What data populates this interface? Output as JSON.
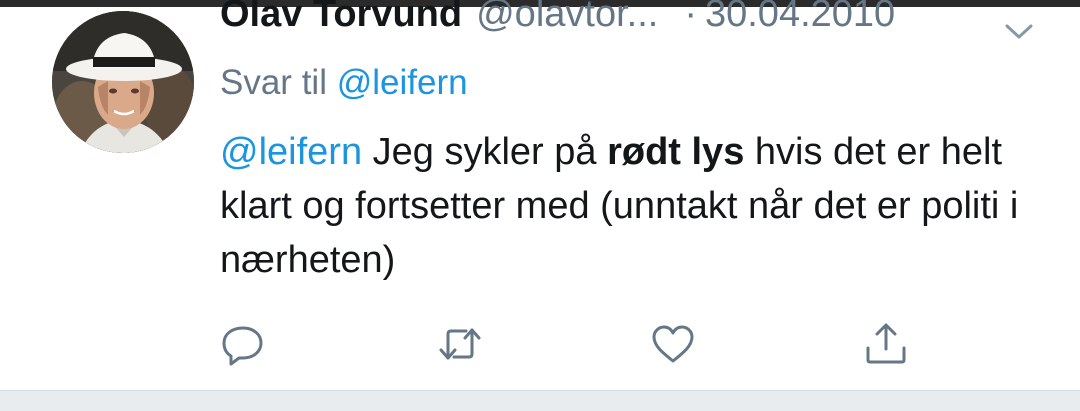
{
  "tweet": {
    "author_name": "Olav Torvund",
    "author_handle": "@olavtor...",
    "separator": "·",
    "date": "30.04.2010",
    "reply_prefix": "Svar til",
    "reply_to": "@leifern",
    "body": {
      "mention": "@leifern",
      "text_1": " Jeg sykler på ",
      "bold": "rødt lys",
      "text_2": " hvis det er helt klart og fortsetter med (unntakt når det er politi i nærheten)"
    }
  },
  "icons": {
    "menu": "chevron-down-icon",
    "reply": "reply-icon",
    "retweet": "retweet-icon",
    "like": "heart-icon",
    "share": "share-icon"
  },
  "colors": {
    "text": "#14171a",
    "secondary": "#657786",
    "link": "#1b95e0",
    "footer": "#e9ecef"
  }
}
